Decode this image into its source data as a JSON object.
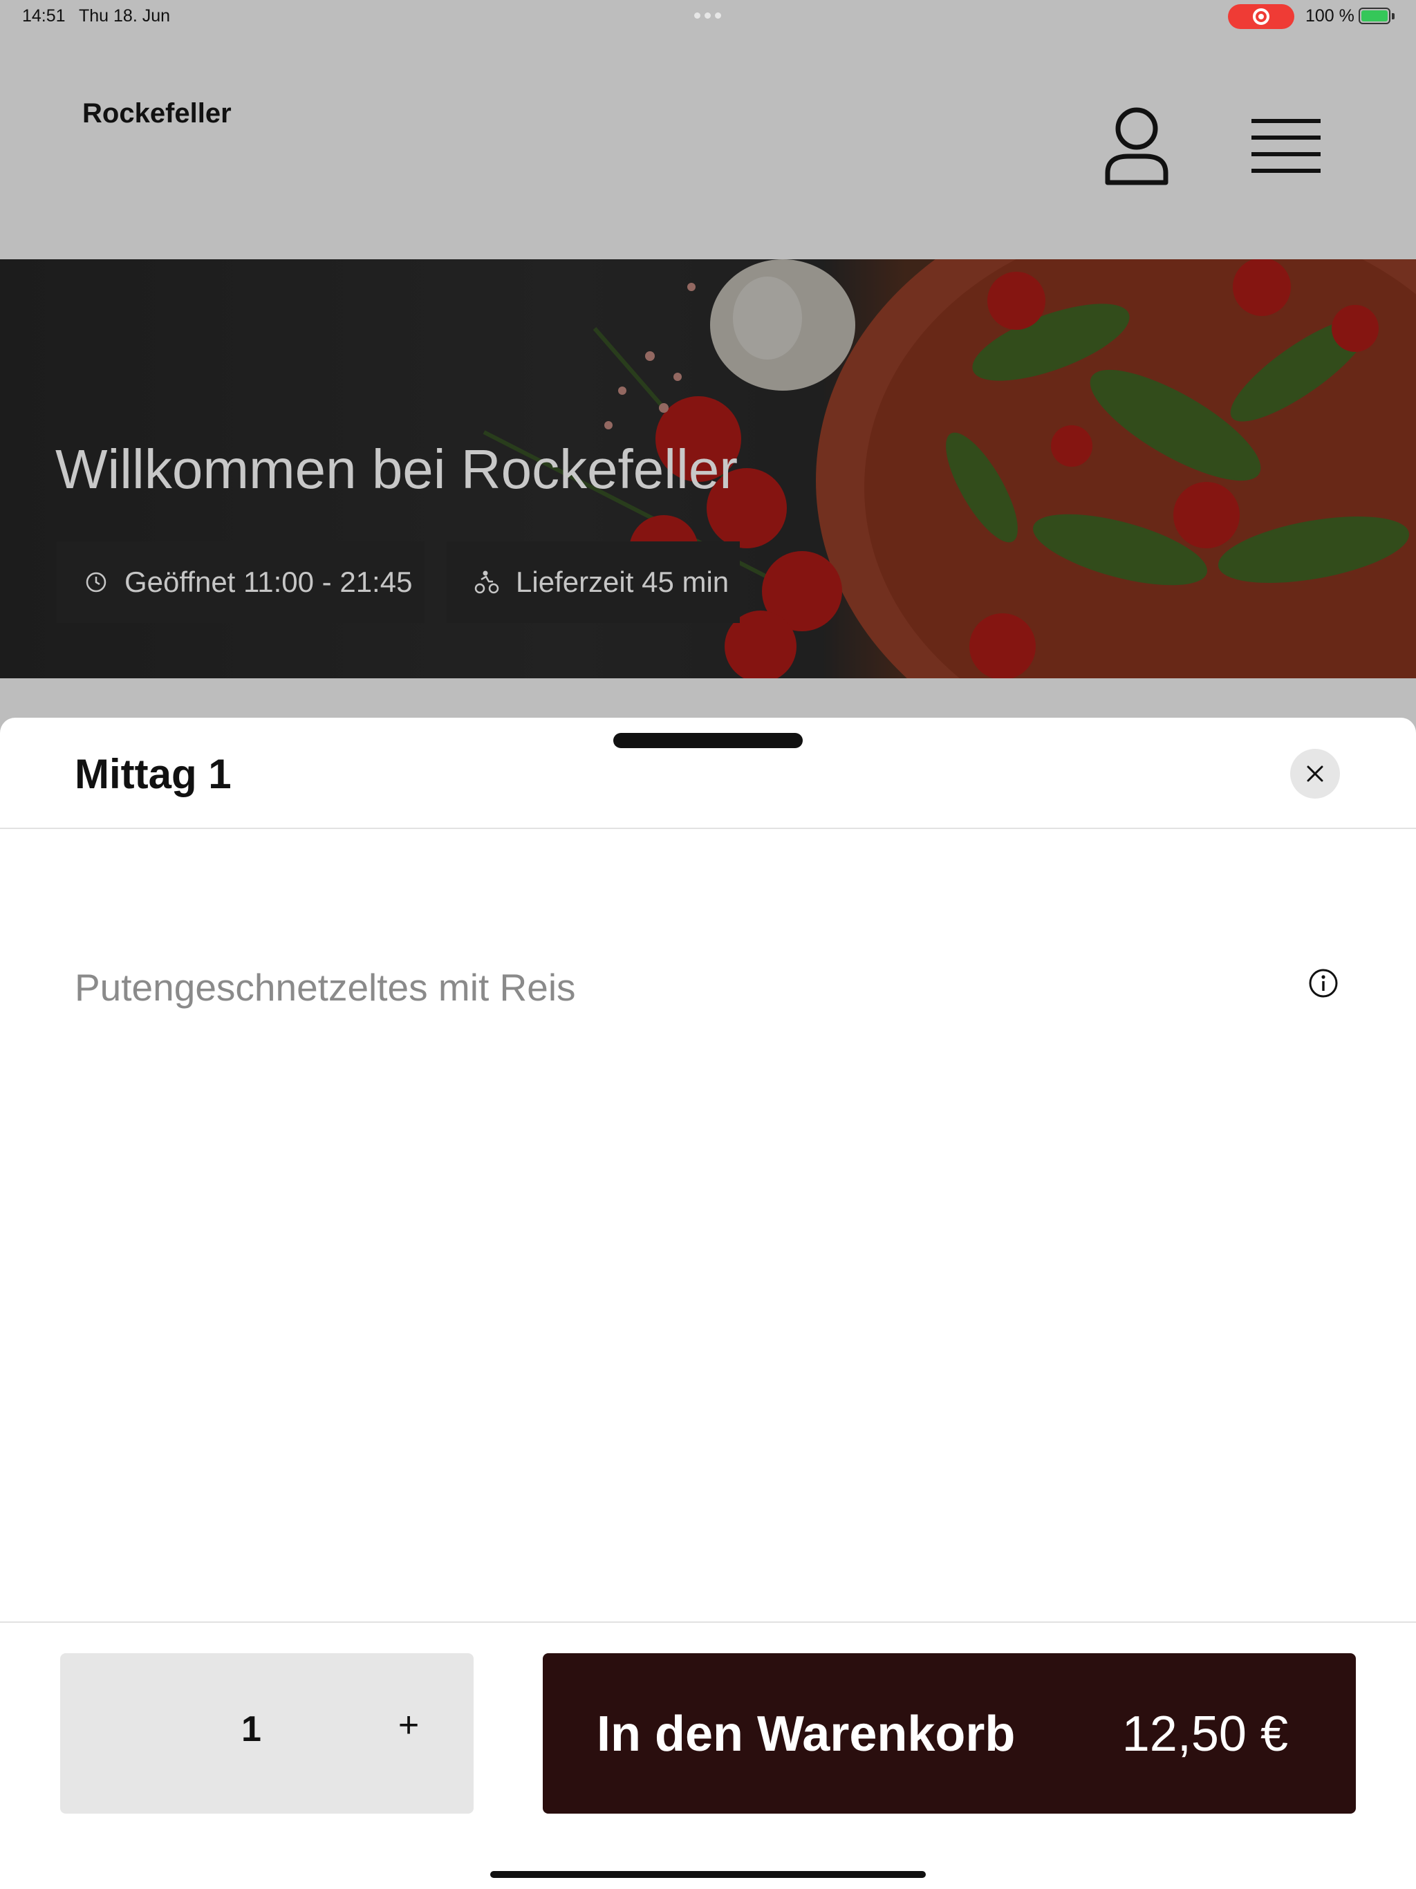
{
  "status_bar": {
    "time": "14:51",
    "date": "Thu 18. Jun",
    "battery": "100 %"
  },
  "header": {
    "brand": "Rockefeller",
    "icons": {
      "account": "user-icon",
      "menu": "hamburger-menu-icon"
    }
  },
  "hero": {
    "title": "Willkommen bei Rockefeller",
    "opening_hours": "Geöffnet 11:00 - 21:45",
    "delivery_time": "Lieferzeit 45 min",
    "icons": {
      "hours": "clock-icon",
      "delivery": "bicycle-courier-icon"
    }
  },
  "sheet": {
    "title": "Mittag 1",
    "item_name": "Putengeschnetzeltes mit Reis",
    "icons": {
      "close": "close-icon",
      "info": "info-icon"
    }
  },
  "order": {
    "quantity": "1",
    "plus_label": "+",
    "add_to_cart_label": "In den Warenkorb",
    "price": "12,50 €"
  },
  "colors": {
    "backdrop": "#bdbdbd",
    "cart_button": "#2a0e0e",
    "quantity_box": "#e6e6e6",
    "recording_indicator": "#ef3b35",
    "battery": "#35c759"
  }
}
